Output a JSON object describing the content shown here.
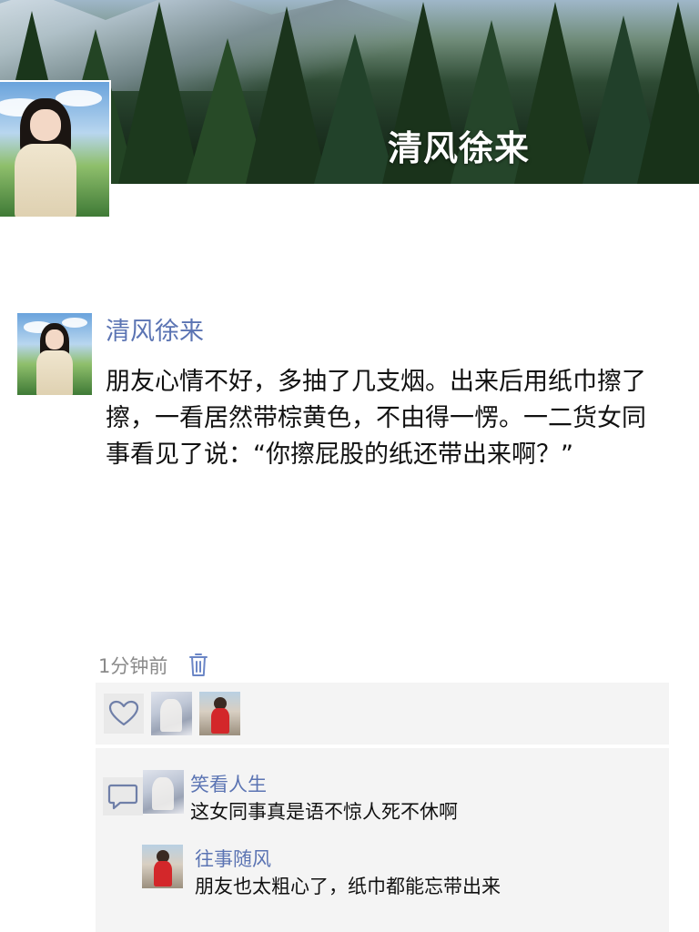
{
  "cover": {
    "title": "清风徐来"
  },
  "post": {
    "author": "清风徐来",
    "content": "朋友心情不好，多抽了几支烟。出来后用纸巾擦了擦，一看居然带棕黄色，不由得一愣。一二货女同事看见了说：“你擦屁股的纸还带出来啊？”",
    "time": "1分钟前"
  },
  "likes": {
    "icon": "heart-outline-icon",
    "avatars": [
      "white-dress-avatar",
      "red-dress-avatar"
    ]
  },
  "comments": [
    {
      "author": "笑看人生",
      "text": "这女同事真是语不惊人死不休啊",
      "avatar": "white-dress-avatar"
    },
    {
      "author": "往事随风",
      "text": "朋友也太粗心了，纸巾都能忘带出来",
      "avatar": "red-dress-avatar"
    }
  ],
  "colors": {
    "name_link": "#5b74b3",
    "time_gray": "#8a8a8a",
    "panel_bg": "#f4f4f4"
  }
}
